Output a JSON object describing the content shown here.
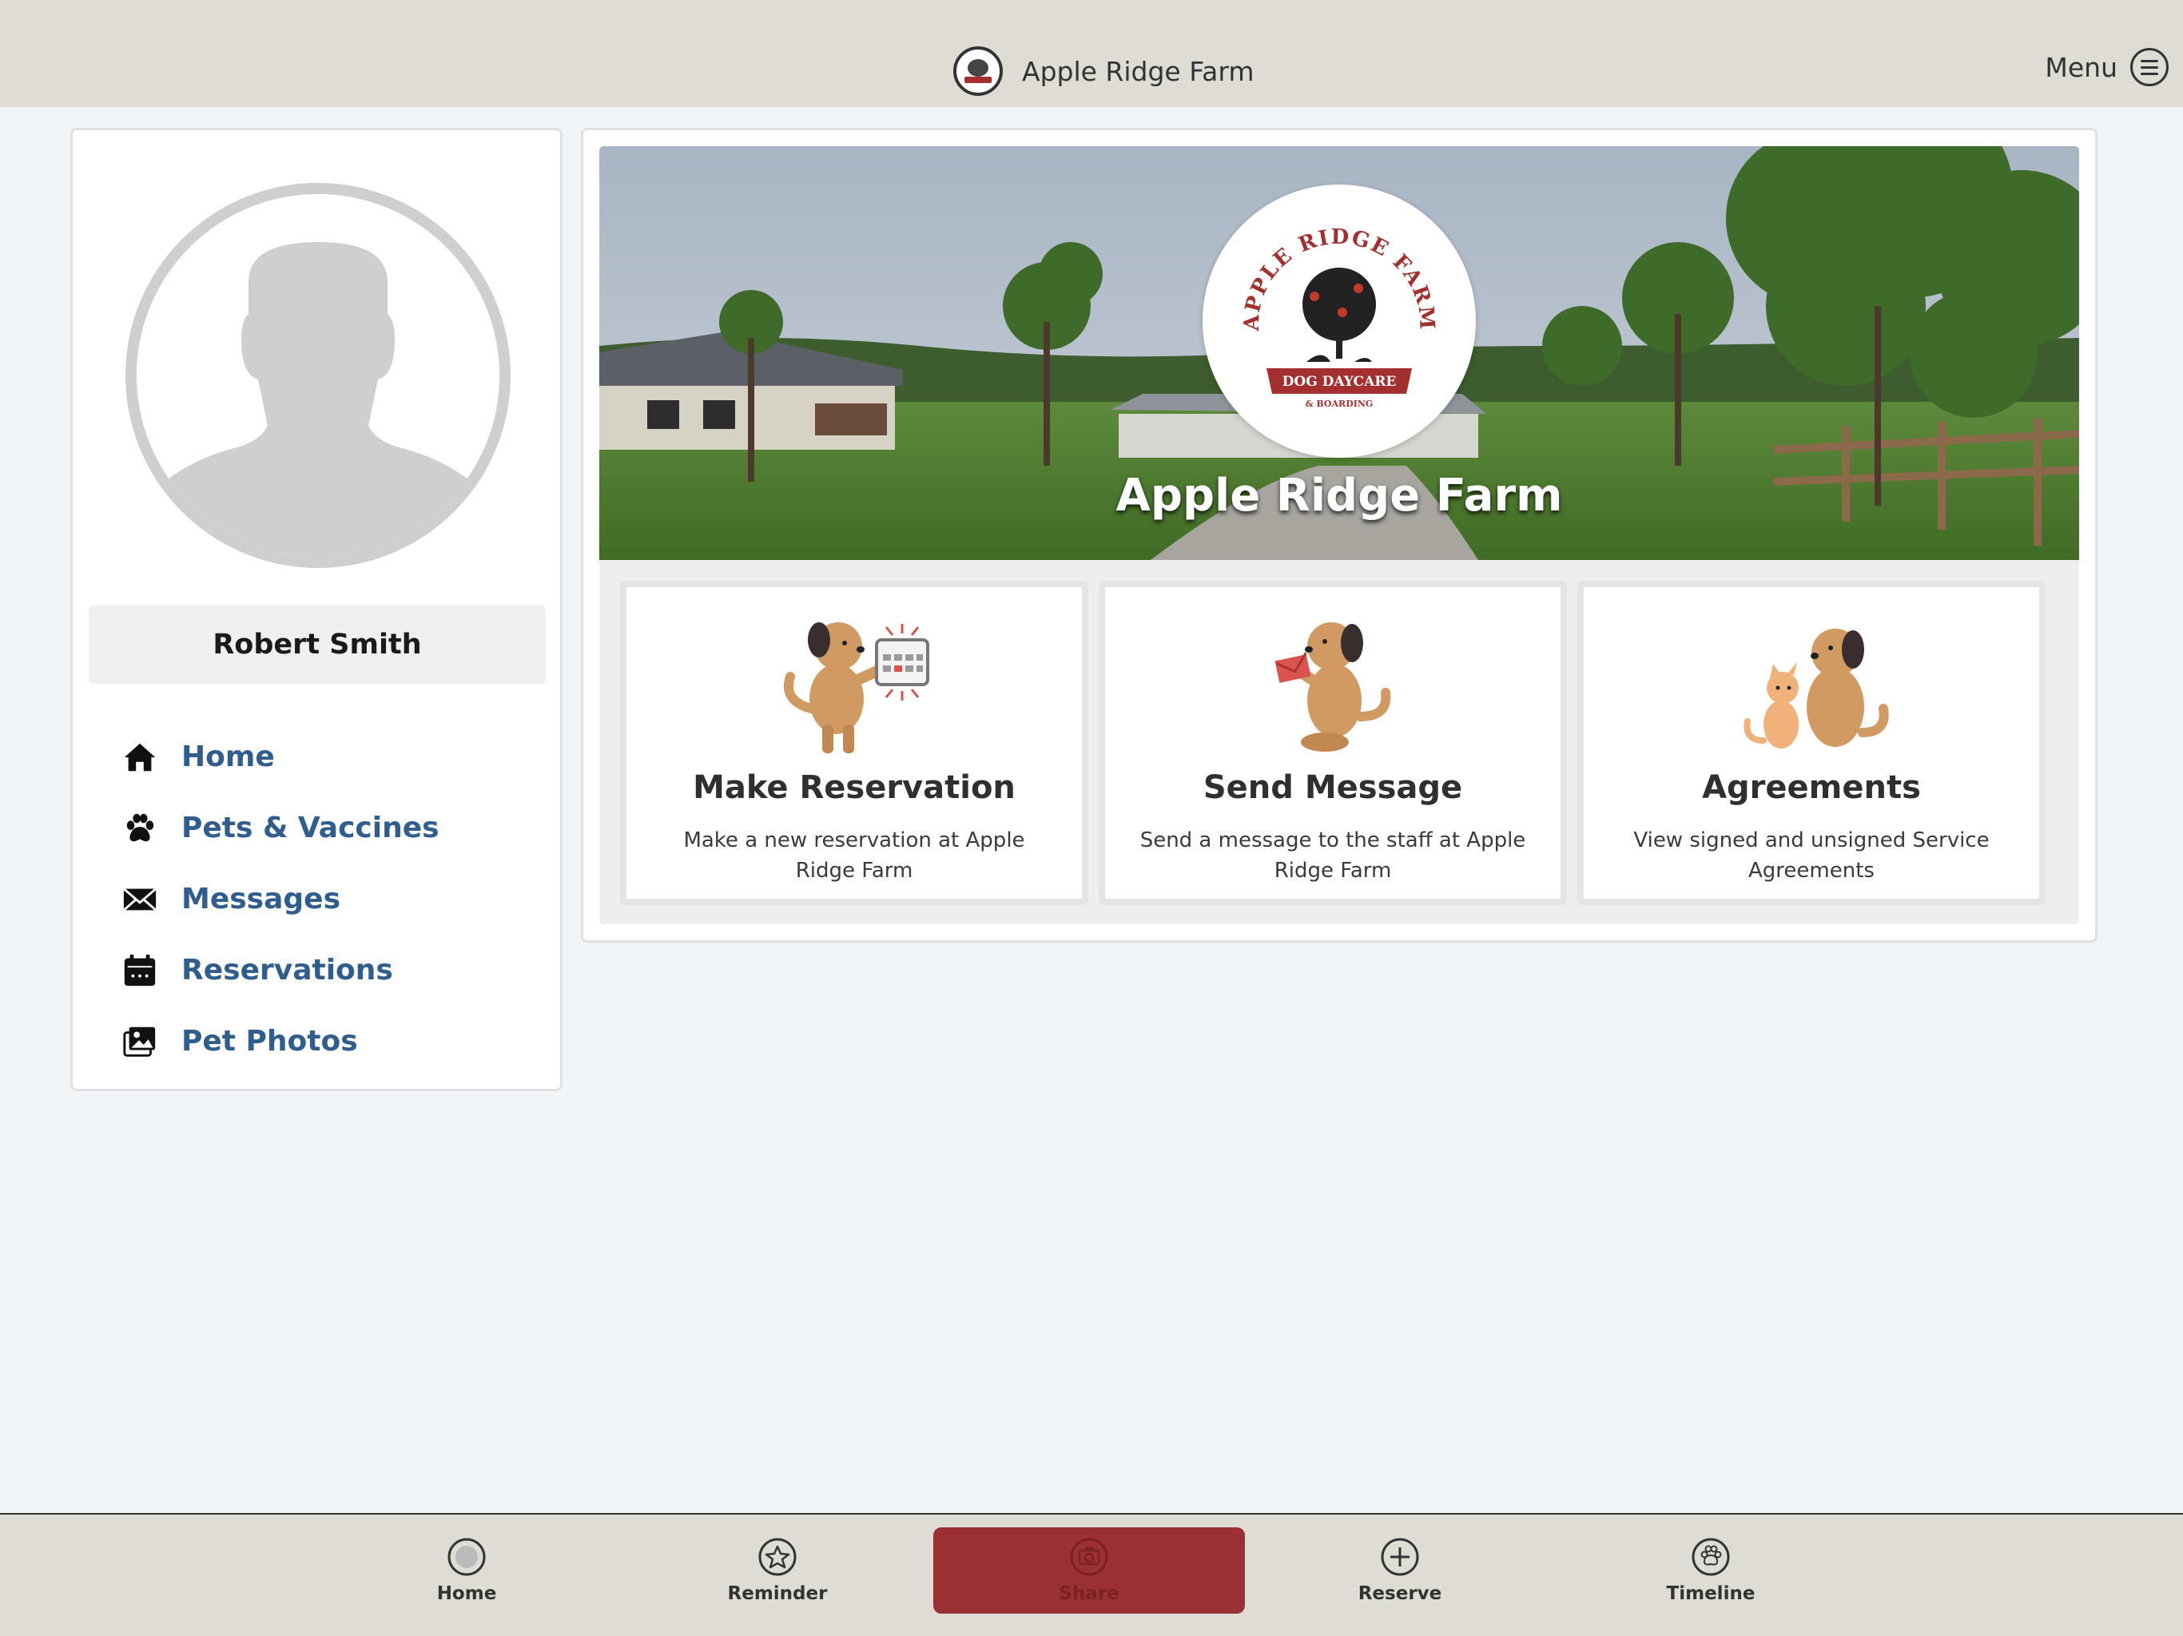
{
  "header": {
    "title": "Apple Ridge Farm",
    "logo_icon": "apple-ridge-farm-logo",
    "menu_label": "Menu",
    "menu_icon": "hamburger-circle-icon"
  },
  "profile": {
    "name": "Robert Smith",
    "avatar_icon": "default-user-avatar"
  },
  "sidebar": {
    "items": [
      {
        "label": "Home",
        "icon": "home-icon"
      },
      {
        "label": "Pets & Vaccines",
        "icon": "paw-icon"
      },
      {
        "label": "Messages",
        "icon": "envelope-icon"
      },
      {
        "label": "Reservations",
        "icon": "calendar-icon"
      },
      {
        "label": "Pet Photos",
        "icon": "photos-icon"
      }
    ]
  },
  "hero": {
    "title": "Apple Ridge Farm",
    "logo_text_top": "APPLE RIDGE FARM",
    "logo_text_banner": "DOG DAYCARE",
    "logo_text_sub": "& BOARDING"
  },
  "actions": [
    {
      "title": "Make Reservation",
      "desc": "Make a new reservation at Apple Ridge Farm",
      "icon": "dog-calendar-illustration"
    },
    {
      "title": "Send Message",
      "desc": "Send a message to the staff at Apple Ridge Farm",
      "icon": "dog-envelope-illustration"
    },
    {
      "title": "Agreements",
      "desc": "View signed and unsigned Service Agreements",
      "icon": "dog-and-cat-illustration"
    }
  ],
  "bottom_nav": {
    "items": [
      {
        "label": "Home",
        "icon": "home-circle-icon",
        "active": false
      },
      {
        "label": "Reminder",
        "icon": "star-circle-icon",
        "active": false
      },
      {
        "label": "Share",
        "icon": "camera-circle-icon",
        "active": true
      },
      {
        "label": "Reserve",
        "icon": "plus-circle-icon",
        "active": false
      },
      {
        "label": "Timeline",
        "icon": "paw-circle-icon",
        "active": false
      }
    ]
  },
  "colors": {
    "bar_background": "#dfddd3",
    "page_background": "#f1f5f8",
    "nav_link": "#2f5e8e",
    "accent_red": "#9a3033"
  }
}
